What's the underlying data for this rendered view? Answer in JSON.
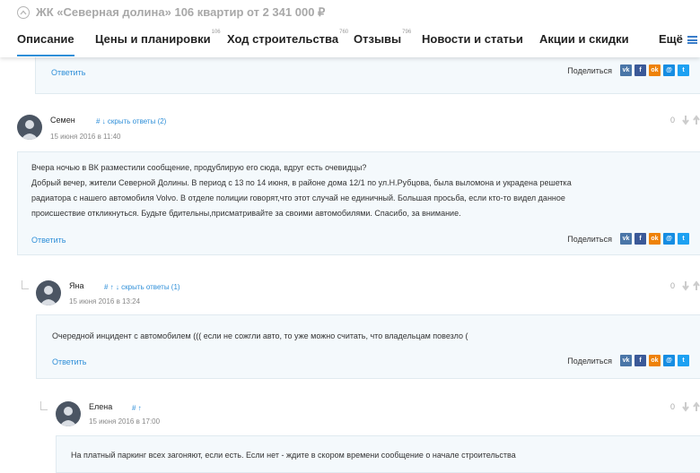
{
  "header": {
    "title": "ЖК «Северная долина» 106 квартир от 2 341 000 ₽",
    "tabs": [
      {
        "label": "Описание",
        "count": ""
      },
      {
        "label": "Цены и планировки",
        "count": "106"
      },
      {
        "label": "Ход строительства",
        "count": "760"
      },
      {
        "label": "Отзывы",
        "count": "796"
      },
      {
        "label": "Новости и статьи",
        "count": ""
      },
      {
        "label": "Акции и скидки",
        "count": ""
      },
      {
        "label": "Ещё",
        "count": ""
      }
    ]
  },
  "common": {
    "reply_label": "Ответить",
    "share_label": "Поделиться",
    "hide_replies_prefix": "скрыть ответы"
  },
  "comments": [
    {
      "author": "Семен",
      "actions": "#  ↓  скрыть ответы (2)",
      "date": "15 июня 2016 в 11:40",
      "score": "0",
      "text_lines": [
        "Вчера ночью в ВК разместили сообщение, продублирую его сюда, вдруг есть очевидцы?",
        "Добрый вечер, жители Северной Долины. В период с 13 по 14 июня, в районе дома 12/1 по ул.Н.Рубцова, была выломона и украдена решетка",
        "радиатора с нашего автомобиля Volvo. В отделе полиции говорят,что этот случай не единичный. Большая просьба, если кто-то видел данное",
        "происшествие откликнуться. Будьте бдительны,присматривайте за своими автомобилями. Спасибо, за внимание."
      ]
    },
    {
      "author": "Яна",
      "actions": "#  ↑  ↓  скрыть ответы (1)",
      "date": "15 июня 2016 в 13:24",
      "score": "0",
      "text_lines": [
        "Очередной инцидент с автомобилем ((( если не сожгли авто, то уже можно считать, что владельцам повезло ("
      ]
    },
    {
      "author": "Елена",
      "actions": "#  ↑",
      "date": "15 июня 2016 в 17:00",
      "score": "0",
      "text_lines": [
        "На платный паркинг всех загоняют, если есть. Если нет - ждите в скором времени сообщение о начале строительства"
      ]
    }
  ],
  "colors": {
    "accent": "#2f8fd8",
    "bubble_bg": "#f4f9fc"
  },
  "icons": [
    "arrow-up-circle-icon",
    "hamburger-menu-icon",
    "avatar-icon",
    "vote-down-icon",
    "vote-up-icon",
    "vk-icon",
    "facebook-icon",
    "odnoklassniki-icon",
    "mymail-icon",
    "twitter-icon"
  ]
}
